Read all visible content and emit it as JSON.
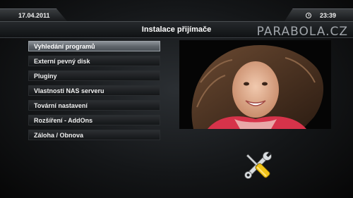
{
  "status": {
    "date": "17.04.2011",
    "time": "23:39"
  },
  "header": {
    "title": "Instalace přijímače",
    "brand": "PARABOLA.CZ"
  },
  "menu": {
    "items": [
      {
        "label": "Vyhledání programů",
        "selected": true
      },
      {
        "label": "Externí pevný disk",
        "selected": false
      },
      {
        "label": "Pluginy",
        "selected": false
      },
      {
        "label": "Vlastnosti NAS serveru",
        "selected": false
      },
      {
        "label": "Tovární nastavení",
        "selected": false
      },
      {
        "label": "Rozšíření - AddOns",
        "selected": false
      },
      {
        "label": "Záloha / Obnova",
        "selected": false
      }
    ]
  },
  "icons": {
    "clock": "clock-icon",
    "tools": "wrench-screwdriver-icon"
  },
  "colors": {
    "selected_item": "#6a7076",
    "background": "#141618"
  }
}
